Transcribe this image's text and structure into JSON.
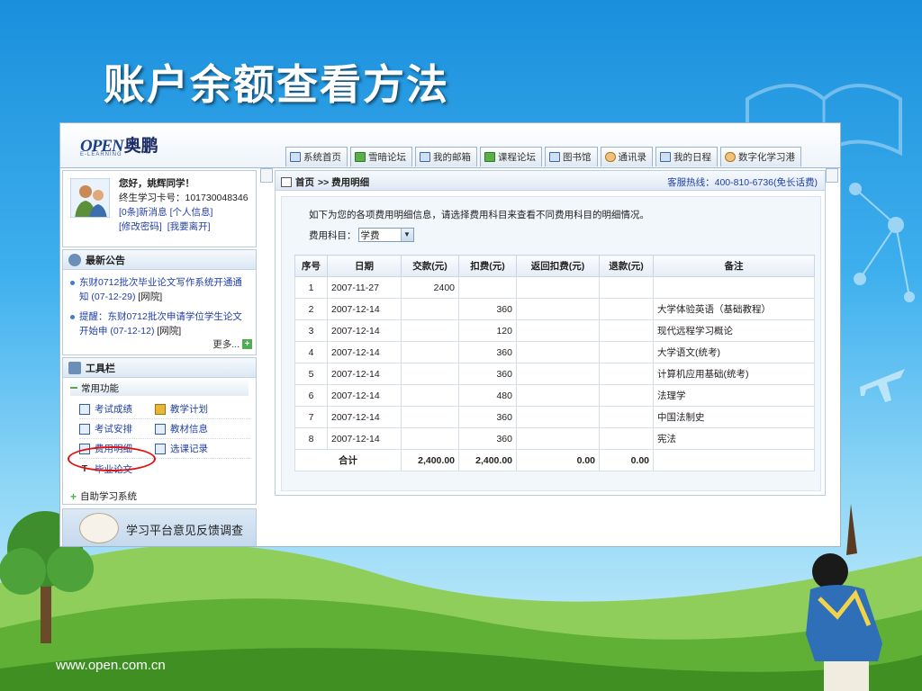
{
  "slide": {
    "title": "账户余额查看方法",
    "footer_url": "www.open.com.cn"
  },
  "app": {
    "logo_text": "OPEN",
    "logo_cn": "奥鹏",
    "logo_sub": "E-LEARNING",
    "tabs": [
      {
        "label": "系统首页",
        "icon": "home-icon"
      },
      {
        "label": "雪暗论坛",
        "icon": "forum-icon"
      },
      {
        "label": "我的邮箱",
        "icon": "mail-icon"
      },
      {
        "label": "课程论坛",
        "icon": "forum-icon"
      },
      {
        "label": "图书馆",
        "icon": "book-icon"
      },
      {
        "label": "通讯录",
        "icon": "contacts-icon"
      },
      {
        "label": "我的日程",
        "icon": "calendar-icon"
      },
      {
        "label": "数字化学习港",
        "icon": "people-icon"
      }
    ]
  },
  "user": {
    "greeting": "您好，姚辉同学！",
    "id_line": "终生学习卡号：101730048346",
    "messages_link": "[0条]新消息",
    "profile_link": "[个人信息]",
    "change_pwd_link": "[修改密码]",
    "logout_link": "[我要离开]"
  },
  "notices": {
    "title": "最新公告",
    "items": [
      {
        "text": "东财0712批次毕业论文写作系统开通通知 (07-12-29)",
        "source": "[网院]"
      },
      {
        "text": "提醒：东财0712批次申请学位学生论文开始申 (07-12-12)",
        "source": "[网院]"
      }
    ],
    "more": "更多..."
  },
  "toolbar": {
    "title": "工具栏",
    "common_title": "常用功能",
    "rows": [
      [
        {
          "label": "考试成绩"
        },
        {
          "label": "教学计划"
        }
      ],
      [
        {
          "label": "考试安排"
        },
        {
          "label": "教材信息"
        }
      ],
      [
        {
          "label": "费用明细"
        },
        {
          "label": "选课记录"
        }
      ],
      [
        {
          "label": "毕业论文"
        }
      ]
    ],
    "self_study": "自助学习系统"
  },
  "survey": {
    "text": "学习平台意见反馈调查"
  },
  "content": {
    "breadcrumb_home": "首页",
    "breadcrumb_current": ">> 费用明细",
    "hotline": "客服热线：400-810-6736(免长话费)",
    "intro": "如下为您的各项费用明细信息，请选择费用科目来查看不同费用科目的明细情况。",
    "subject_label": "费用科目：",
    "subject_value": "学费",
    "table": {
      "headers": [
        "序号",
        "日期",
        "交款(元)",
        "扣费(元)",
        "返回扣费(元)",
        "退款(元)",
        "备注"
      ],
      "rows": [
        [
          "1",
          "2007-11-27",
          "2400",
          "",
          "",
          "",
          ""
        ],
        [
          "2",
          "2007-12-14",
          "",
          "360",
          "",
          "",
          "大学体验英语（基础教程）"
        ],
        [
          "3",
          "2007-12-14",
          "",
          "120",
          "",
          "",
          "现代远程学习概论"
        ],
        [
          "4",
          "2007-12-14",
          "",
          "360",
          "",
          "",
          "大学语文(统考)"
        ],
        [
          "5",
          "2007-12-14",
          "",
          "360",
          "",
          "",
          "计算机应用基础(统考)"
        ],
        [
          "6",
          "2007-12-14",
          "",
          "480",
          "",
          "",
          "法理学"
        ],
        [
          "7",
          "2007-12-14",
          "",
          "360",
          "",
          "",
          "中国法制史"
        ],
        [
          "8",
          "2007-12-14",
          "",
          "360",
          "",
          "",
          "宪法"
        ]
      ],
      "total": [
        "合计",
        "2,400.00",
        "2,400.00",
        "0.00",
        "0.00"
      ]
    }
  },
  "colors": {
    "link": "#1f3fa6",
    "highlight_circle": "#e01010"
  }
}
